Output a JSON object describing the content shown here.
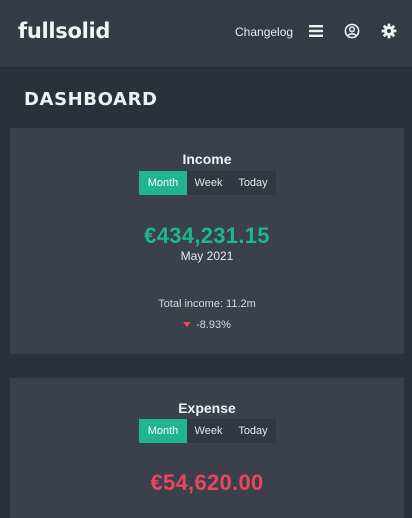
{
  "header": {
    "logo": "fullsolid",
    "changelog_label": "Changelog",
    "icons": [
      "menu-icon",
      "user-circle-icon",
      "gear-icon"
    ]
  },
  "page": {
    "title": "DASHBOARD"
  },
  "income_card": {
    "title": "Income",
    "tabs": [
      "Month",
      "Week",
      "Today"
    ],
    "selected_tab": "Month",
    "amount": "€434,231.15",
    "period": "May 2021",
    "total": "Total income: 11.2m",
    "change": "-8.93%"
  },
  "expense_card": {
    "title": "Expense",
    "tabs": [
      "Month",
      "Week",
      "Today"
    ],
    "selected_tab": "Month",
    "amount": "€54,620.00"
  },
  "colors": {
    "accent": "#1fb58f",
    "negative": "#e8475f",
    "background": "#2b3139",
    "card": "#3a414a",
    "topbar": "#343b44"
  }
}
